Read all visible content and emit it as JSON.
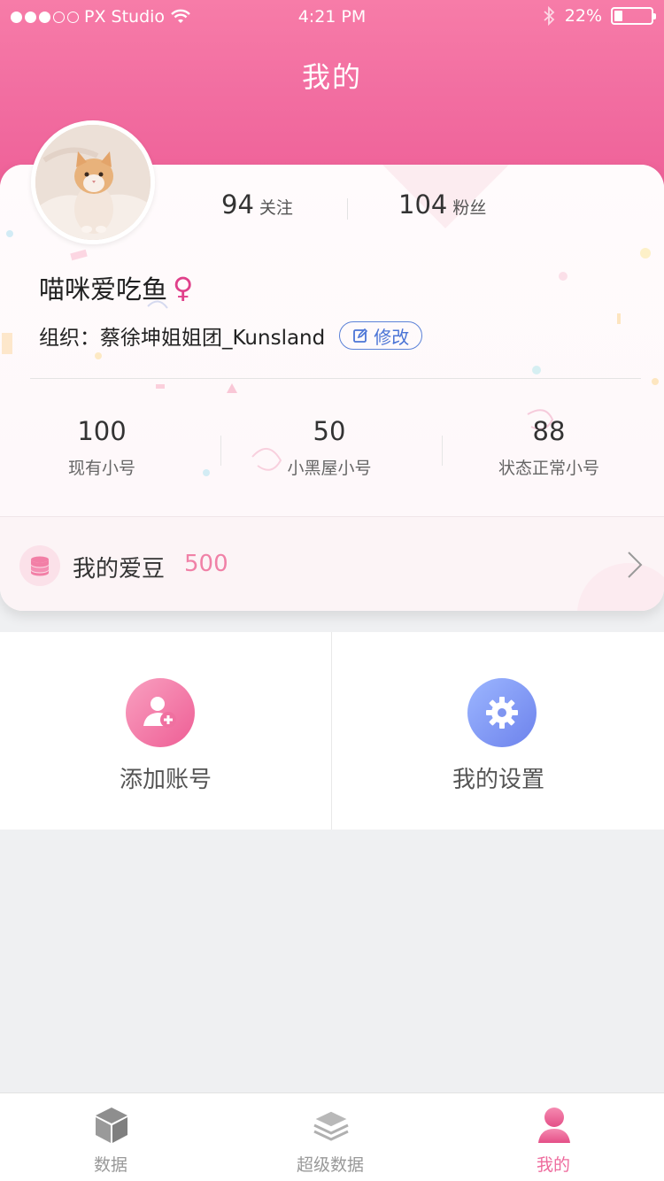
{
  "status_bar": {
    "carrier": "PX Studio",
    "time": "4:21 PM",
    "battery": "22%",
    "battery_level": 0.22,
    "signal_bars_filled": 3,
    "signal_bars_total": 5
  },
  "header": {
    "title": "我的"
  },
  "profile": {
    "following_count": "94",
    "following_label": "关注",
    "followers_count": "104",
    "followers_label": "粉丝",
    "username": "喵咪爱吃鱼",
    "gender_symbol": "♀",
    "org_label": "组织：",
    "org_name": "蔡徐坤姐姐团_Kunsland",
    "edit_label": "修改"
  },
  "accounts": [
    {
      "value": "100",
      "label": "现有小号"
    },
    {
      "value": "50",
      "label": "小黑屋小号"
    },
    {
      "value": "88",
      "label": "状态正常小号"
    }
  ],
  "beans": {
    "label": "我的爱豆",
    "value": "500"
  },
  "actions": [
    {
      "label": "添加账号",
      "icon": "add-user-icon"
    },
    {
      "label": "我的设置",
      "icon": "gear-icon"
    }
  ],
  "tabs": [
    {
      "label": "数据",
      "icon": "cube-icon",
      "active": false
    },
    {
      "label": "超级数据",
      "icon": "layers-icon",
      "active": false
    },
    {
      "label": "我的",
      "icon": "person-icon",
      "active": true
    }
  ],
  "colors": {
    "brand_pink": "#ee5f97",
    "accent_blue": "#5b82d8",
    "beans_value": "#f081a7"
  }
}
